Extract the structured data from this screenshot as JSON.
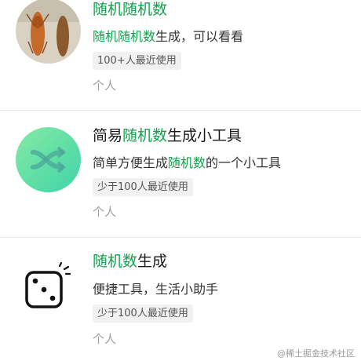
{
  "results": [
    {
      "title_parts": [
        "随机随机数",
        ""
      ],
      "desc_parts": [
        "随机随机数",
        "生成，可以看看"
      ],
      "tag": "100+人最近使用",
      "category": "个人",
      "icon": "shrimp-photo-icon"
    },
    {
      "title_parts": [
        "简易",
        "随机数",
        "生成小工具"
      ],
      "desc_parts": [
        "简单方便生成",
        "随机数",
        "的一个小工具"
      ],
      "tag": "少于100人最近使用",
      "category": "个人",
      "icon": "shuffle-icon"
    },
    {
      "title_parts": [
        "随机数",
        "生成"
      ],
      "desc": "便捷工具，生活小助手",
      "tag": "少于100人最近使用",
      "category": "个人",
      "icon": "dice-icon"
    }
  ],
  "watermark": "@稀土掘金技术社区",
  "colors": {
    "highlight": "#14a14e",
    "shuffle_gradient": [
      "#7ee8a8",
      "#43d6a6"
    ]
  }
}
